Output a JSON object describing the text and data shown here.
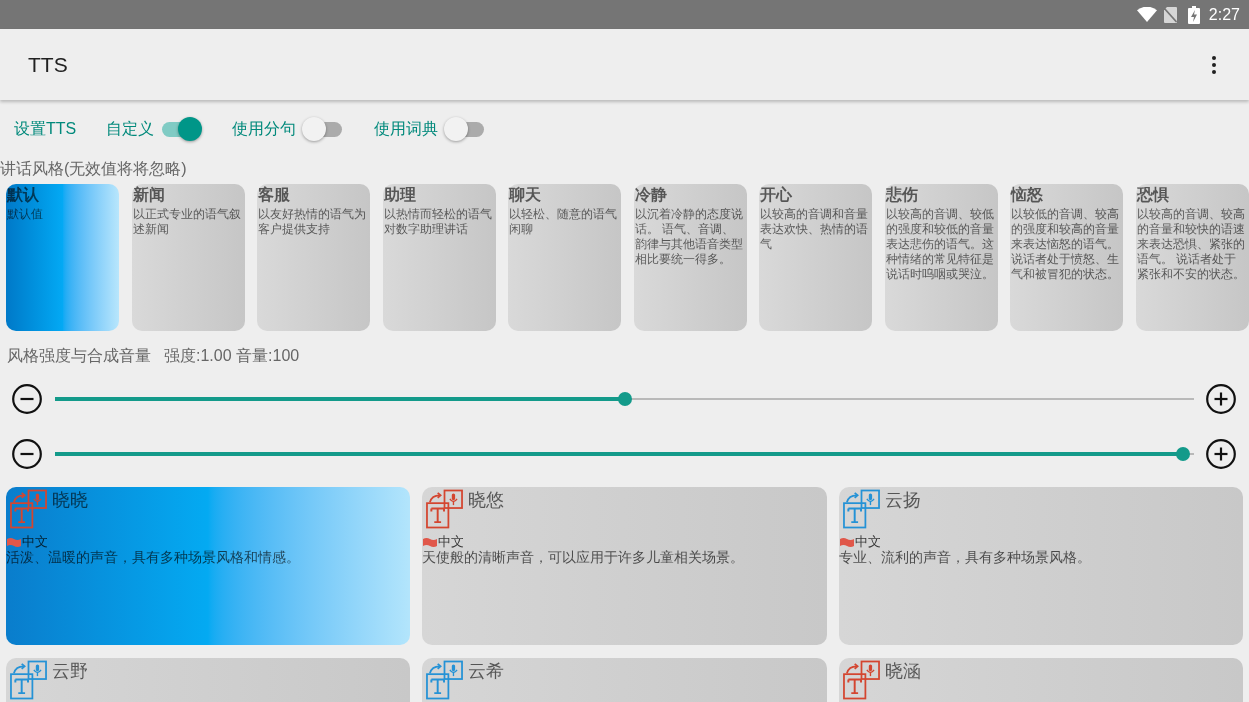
{
  "status_bar": {
    "time": "2:27"
  },
  "app_bar": {
    "title": "TTS"
  },
  "options": [
    {
      "kind": "button",
      "label": "设置TTS"
    },
    {
      "kind": "switch",
      "label": "自定义",
      "on": true
    },
    {
      "kind": "switch",
      "label": "使用分句",
      "on": false
    },
    {
      "kind": "switch",
      "label": "使用词典",
      "on": false
    }
  ],
  "style_section": {
    "heading": "讲话风格(无效值将将忽略)",
    "styles": [
      {
        "name": "默认",
        "description": "默认值",
        "selected": true
      },
      {
        "name": "新闻",
        "description": "以正式专业的语气叙述新闻",
        "selected": false
      },
      {
        "name": "客服",
        "description": "以友好热情的语气为客户提供支持",
        "selected": false
      },
      {
        "name": "助理",
        "description": "以热情而轻松的语气对数字助理讲话",
        "selected": false
      },
      {
        "name": "聊天",
        "description": "以轻松、随意的语气闲聊",
        "selected": false
      },
      {
        "name": "冷静",
        "description": "以沉着冷静的态度说话。 语气、音调、韵律与其他语音类型相比要统一得多。",
        "selected": false
      },
      {
        "name": "开心",
        "description": "以较高的音调和音量表达欢快、热情的语气",
        "selected": false
      },
      {
        "name": "悲伤",
        "description": "以较高的音调、较低的强度和较低的音量表达悲伤的语气。这种情绪的常见特征是说话时呜咽或哭泣。",
        "selected": false
      },
      {
        "name": "恼怒",
        "description": "以较低的音调、较高的强度和较高的音量来表达恼怒的语气。说话者处于愤怒、生气和被冒犯的状态。",
        "selected": false
      },
      {
        "name": "恐惧",
        "description": "以较高的音调、较高的音量和较快的语速来表达恐惧、紧张的语气。 说话者处于紧张和不安的状态。",
        "selected": false
      }
    ]
  },
  "strength_section": {
    "heading": "风格强度与合成音量",
    "reading": "强度:1.00 音量:100",
    "sliders": [
      {
        "level": 0.5
      },
      {
        "level": 0.99
      }
    ]
  },
  "voices": [
    {
      "name": "晓晓",
      "language": "中文",
      "description": "活泼、温暖的声音，具有多种场景风格和情感。",
      "color": "#d4452f",
      "selected": true
    },
    {
      "name": "晓悠",
      "language": "中文",
      "description": "天使般的清晰声音，可以应用于许多儿童相关场景。",
      "color": "#d4452f",
      "selected": false
    },
    {
      "name": "云扬",
      "language": "中文",
      "description": "专业、流利的声音，具有多种场景风格。",
      "color": "#2492d6",
      "selected": false
    },
    {
      "name": "云野",
      "color": "#2492d6",
      "selected": false
    },
    {
      "name": "云希",
      "color": "#2492d6",
      "selected": false
    },
    {
      "name": "晓涵",
      "color": "#d4452f",
      "selected": false
    }
  ]
}
